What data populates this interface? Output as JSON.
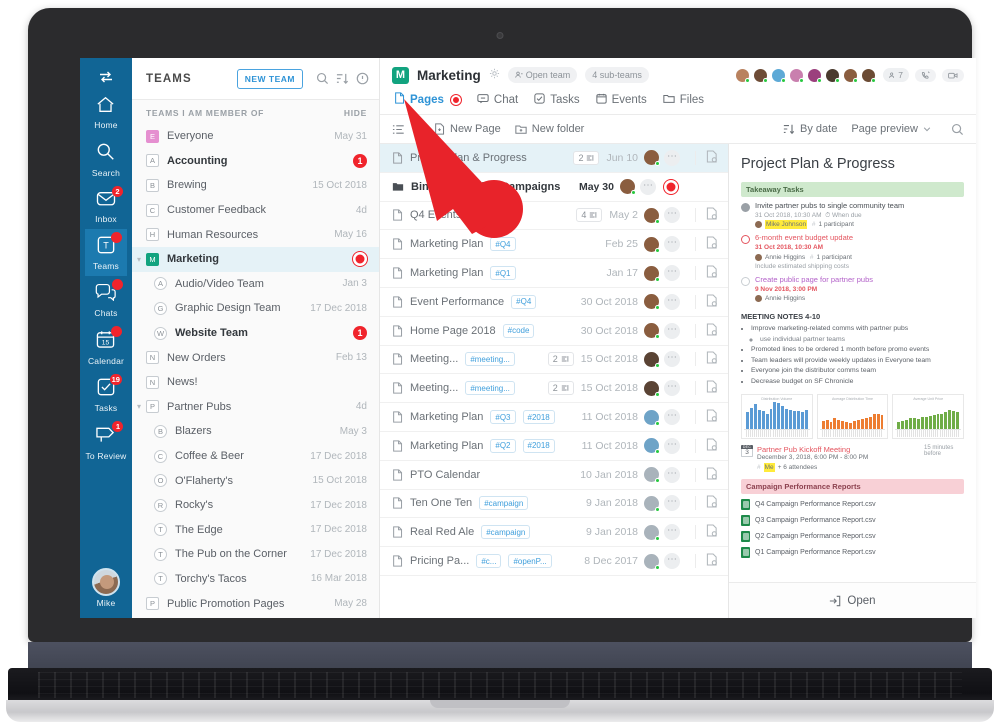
{
  "rail": {
    "toggle_icon": "switch-icon",
    "items": [
      {
        "label": "Home",
        "icon": "home-icon",
        "badge": "",
        "active": false
      },
      {
        "label": "Search",
        "icon": "search-icon",
        "badge": "",
        "active": false
      },
      {
        "label": "Inbox",
        "icon": "inbox-icon",
        "badge": "2",
        "active": false
      },
      {
        "label": "Teams",
        "icon": "teams-icon",
        "badge": " ",
        "active": true
      },
      {
        "label": "Chats",
        "icon": "chats-icon",
        "badge": " ",
        "active": false
      },
      {
        "label": "Calendar",
        "icon": "calendar-icon",
        "badge": " ",
        "active": false
      },
      {
        "label": "Tasks",
        "icon": "tasks-icon",
        "badge": "19",
        "active": false
      },
      {
        "label": "To Review",
        "icon": "to-review-icon",
        "badge": "1",
        "active": false
      }
    ],
    "user_name": "Mike"
  },
  "teams_panel": {
    "title": "TEAMS",
    "new_team_label": "NEW TEAM",
    "search_icon": "search-icon",
    "sort_icon": "sort-icon",
    "info_icon": "info-icon",
    "section_label": "TEAMS I AM MEMBER OF",
    "hide_label": "HIDE",
    "items": [
      {
        "initial": "E",
        "name": "Everyone",
        "date": "May 31",
        "badge": "",
        "bold": false,
        "indent": 0,
        "style": "pink",
        "expandable": false
      },
      {
        "initial": "A",
        "name": "Accounting",
        "date": "",
        "badge": "1",
        "bold": true,
        "indent": 0,
        "style": "plain",
        "expandable": false
      },
      {
        "initial": "B",
        "name": "Brewing",
        "date": "15 Oct 2018",
        "badge": "",
        "bold": false,
        "indent": 0,
        "style": "plain",
        "expandable": false
      },
      {
        "initial": "C",
        "name": "Customer Feedback",
        "date": "4d",
        "badge": "",
        "bold": false,
        "indent": 0,
        "style": "plain",
        "expandable": false
      },
      {
        "initial": "H",
        "name": "Human Resources",
        "date": "May 16",
        "badge": "",
        "bold": false,
        "indent": 0,
        "style": "plain",
        "expandable": false
      },
      {
        "initial": "M",
        "name": "Marketing",
        "date": "",
        "badge": "ring",
        "bold": true,
        "indent": 0,
        "style": "green",
        "expandable": true,
        "selected": true
      },
      {
        "initial": "A",
        "name": "Audio/Video Team",
        "date": "Jan 3",
        "badge": "",
        "bold": false,
        "indent": 1,
        "style": "circ",
        "expandable": false
      },
      {
        "initial": "G",
        "name": "Graphic Design Team",
        "date": "17 Dec 2018",
        "badge": "",
        "bold": false,
        "indent": 1,
        "style": "circ",
        "expandable": false
      },
      {
        "initial": "W",
        "name": "Website Team",
        "date": "",
        "badge": "1",
        "bold": true,
        "indent": 1,
        "style": "circ",
        "expandable": false
      },
      {
        "initial": "N",
        "name": "New Orders",
        "date": "Feb 13",
        "badge": "",
        "bold": false,
        "indent": 0,
        "style": "plain",
        "expandable": false
      },
      {
        "initial": "N",
        "name": "News!",
        "date": "",
        "badge": "",
        "bold": false,
        "indent": 0,
        "style": "plain",
        "expandable": false
      },
      {
        "initial": "P",
        "name": "Partner Pubs",
        "date": "4d",
        "badge": "",
        "bold": false,
        "indent": 0,
        "style": "plain",
        "expandable": true
      },
      {
        "initial": "B",
        "name": "Blazers",
        "date": "May 3",
        "badge": "",
        "bold": false,
        "indent": 1,
        "style": "circ",
        "expandable": false
      },
      {
        "initial": "C",
        "name": "Coffee & Beer",
        "date": "17 Dec 2018",
        "badge": "",
        "bold": false,
        "indent": 1,
        "style": "circ",
        "expandable": false
      },
      {
        "initial": "O",
        "name": "O'Flaherty's",
        "date": "15 Oct 2018",
        "badge": "",
        "bold": false,
        "indent": 1,
        "style": "circ",
        "expandable": false
      },
      {
        "initial": "R",
        "name": "Rocky's",
        "date": "17 Dec 2018",
        "badge": "",
        "bold": false,
        "indent": 1,
        "style": "circ",
        "expandable": false
      },
      {
        "initial": "T",
        "name": "The Edge",
        "date": "17 Dec 2018",
        "badge": "",
        "bold": false,
        "indent": 1,
        "style": "circ",
        "expandable": false
      },
      {
        "initial": "T",
        "name": "The Pub on the Corner",
        "date": "17 Dec 2018",
        "badge": "",
        "bold": false,
        "indent": 1,
        "style": "circ",
        "expandable": false
      },
      {
        "initial": "T",
        "name": "Torchy's Tacos",
        "date": "16 Mar 2018",
        "badge": "",
        "bold": false,
        "indent": 1,
        "style": "circ",
        "expandable": false
      },
      {
        "initial": "P",
        "name": "Public Promotion Pages",
        "date": "May 28",
        "badge": "",
        "bold": false,
        "indent": 0,
        "style": "plain",
        "expandable": false
      }
    ]
  },
  "channel": {
    "initial": "M",
    "name": "Marketing",
    "gear_icon": "gear-icon",
    "open_team_pill": "Open team",
    "sub_teams_pill": "4 sub-teams",
    "members_count": "7",
    "call_icon": "phone-icon",
    "video_icon": "video-icon",
    "tabs": [
      {
        "label": "Pages",
        "icon": "page-icon",
        "active": true,
        "dot": true
      },
      {
        "label": "Chat",
        "icon": "chat-icon",
        "active": false,
        "dot": false
      },
      {
        "label": "Tasks",
        "icon": "check-icon",
        "active": false,
        "dot": false
      },
      {
        "label": "Events",
        "icon": "calendar-icon",
        "active": false,
        "dot": false
      },
      {
        "label": "Files",
        "icon": "folder-icon",
        "active": false,
        "dot": false
      }
    ]
  },
  "toolbar": {
    "list_view_icon": "list-view-icon",
    "new_page_label": "New Page",
    "new_folder_label": "New folder",
    "sort_label": "By date",
    "sort_icon": "sort-icon",
    "preview_label": "Page preview",
    "search_icon": "search-icon"
  },
  "files": [
    {
      "name": "Project Plan & Progress",
      "type": "page",
      "tags": [],
      "comments": "2",
      "date": "Jun 10",
      "bold": false,
      "selected": true,
      "has_end_icon": true,
      "unread": false
    },
    {
      "name": "Bine Advertising Campaigns",
      "type": "folder",
      "tags": [],
      "comments": "",
      "date": "May 30",
      "bold": true,
      "selected": false,
      "has_end_icon": false,
      "unread": true
    },
    {
      "name": "Q4 Events",
      "type": "page",
      "tags": [],
      "comments": "4",
      "date": "May 2",
      "bold": false,
      "selected": false,
      "has_end_icon": true,
      "unread": false
    },
    {
      "name": "Marketing Plan",
      "type": "page",
      "tags": [
        "#Q4"
      ],
      "comments": "",
      "date": "Feb 25",
      "bold": false,
      "selected": false,
      "has_end_icon": true,
      "unread": false
    },
    {
      "name": "Marketing Plan",
      "type": "page",
      "tags": [
        "#Q1"
      ],
      "comments": "",
      "date": "Jan 17",
      "bold": false,
      "selected": false,
      "has_end_icon": true,
      "unread": false
    },
    {
      "name": "Event Performance",
      "type": "page",
      "tags": [
        "#Q4"
      ],
      "comments": "",
      "date": "30 Oct 2018",
      "bold": false,
      "selected": false,
      "has_end_icon": true,
      "unread": false
    },
    {
      "name": "Home Page 2018",
      "type": "page",
      "tags": [
        "#code"
      ],
      "comments": "",
      "date": "30 Oct 2018",
      "bold": false,
      "selected": false,
      "has_end_icon": true,
      "unread": false
    },
    {
      "name": "Meeting...",
      "type": "page",
      "tags": [
        "#meeting..."
      ],
      "comments": "2",
      "date": "15 Oct 2018",
      "bold": false,
      "selected": false,
      "has_end_icon": true,
      "unread": false
    },
    {
      "name": "Meeting...",
      "type": "page",
      "tags": [
        "#meeting..."
      ],
      "comments": "2",
      "date": "15 Oct 2018",
      "bold": false,
      "selected": false,
      "has_end_icon": true,
      "unread": false
    },
    {
      "name": "Marketing Plan",
      "type": "page",
      "tags": [
        "#Q3",
        "#2018"
      ],
      "comments": "",
      "date": "11 Oct 2018",
      "bold": false,
      "selected": false,
      "has_end_icon": true,
      "unread": false
    },
    {
      "name": "Marketing Plan",
      "type": "page",
      "tags": [
        "#Q2",
        "#2018"
      ],
      "comments": "",
      "date": "11 Oct 2018",
      "bold": false,
      "selected": false,
      "has_end_icon": true,
      "unread": false
    },
    {
      "name": "PTO Calendar",
      "type": "page",
      "tags": [],
      "comments": "",
      "date": "10 Jan 2018",
      "bold": false,
      "selected": false,
      "has_end_icon": true,
      "unread": false
    },
    {
      "name": "Ten One Ten",
      "type": "page",
      "tags": [
        "#campaign"
      ],
      "comments": "",
      "date": "9 Jan 2018",
      "bold": false,
      "selected": false,
      "has_end_icon": true,
      "unread": false
    },
    {
      "name": "Real Red Ale",
      "type": "page",
      "tags": [
        "#campaign"
      ],
      "comments": "",
      "date": "9 Jan 2018",
      "bold": false,
      "selected": false,
      "has_end_icon": true,
      "unread": false
    },
    {
      "name": "Pricing Pa...",
      "type": "page",
      "tags": [
        "#c...",
        "#openP..."
      ],
      "comments": "",
      "date": "8 Dec 2017",
      "bold": false,
      "selected": false,
      "has_end_icon": true,
      "unread": false
    }
  ],
  "preview": {
    "title": "Project Plan & Progress",
    "takeaway_band": "Takeaway Tasks",
    "tasks": [
      {
        "state": "done",
        "title": "Invite partner pubs to single community team",
        "meta": "31 Oct 2018, 10:30 AM",
        "meta2": "When due",
        "person": "Mike Johnson",
        "person_highlight": true,
        "participants": "1 participant",
        "note": ""
      },
      {
        "state": "late",
        "title": "6-month event budget update",
        "meta": "31 Oct 2018, 10:30 AM",
        "meta2": "",
        "person": "Annie Higgins",
        "person_highlight": false,
        "participants": "1 participant",
        "note": "Include estimated shipping costs"
      },
      {
        "state": "open",
        "title": "Create public page for partner pubs",
        "meta": "9 Nov 2018, 3:00 PM",
        "meta2": "",
        "person": "Annie Higgins",
        "person_highlight": false,
        "participants": "",
        "note": ""
      }
    ],
    "notes_heading": "MEETING NOTES 4-10",
    "notes": [
      {
        "text": "Improve marketing-related comms with partner pubs",
        "sub": false
      },
      {
        "text": "use individual partner teams",
        "sub": true
      },
      {
        "text": "Promoted lines to be ordered 1 month before promo events",
        "sub": false
      },
      {
        "text": "Team leaders will provide weekly updates in Everyone team",
        "sub": false
      },
      {
        "text": "Everyone join the distributor comms team",
        "sub": false
      },
      {
        "text": "Decrease budget on SF Chronicle",
        "sub": false
      }
    ],
    "event": {
      "cal_month": "DEC",
      "cal_day": "3",
      "title": "Partner Pub Kickoff Meeting",
      "datetime": "December 3, 2018, 6:00 PM - 8:00 PM",
      "attendees_me": "Me",
      "attendees_rest": "+ 6 attendees",
      "reminder": "15 minutes before"
    },
    "reports_band": "Campaign Performance Reports",
    "reports": [
      "Q4 Campaign Performance Report.csv",
      "Q3 Campaign Performance Report.csv",
      "Q2 Campaign Performance Report.csv",
      "Q1 Campaign Performance Report.csv"
    ],
    "open_label": "Open",
    "open_icon": "open-icon"
  },
  "chart_data": [
    {
      "type": "bar",
      "title": "Distribution Volume",
      "color": "#5b9bd5",
      "categories": [
        "1",
        "2",
        "3",
        "4",
        "5",
        "6",
        "7",
        "8",
        "9",
        "10",
        "11",
        "12",
        "13",
        "14",
        "15",
        "16"
      ],
      "values": [
        62,
        78,
        92,
        70,
        66,
        55,
        74,
        100,
        96,
        86,
        74,
        70,
        68,
        66,
        64,
        70
      ],
      "xlabel": "",
      "ylabel": "",
      "ylim": [
        0,
        100
      ]
    },
    {
      "type": "bar",
      "title": "Average Distribution Time",
      "color": "#ed7d31",
      "categories": [
        "1",
        "2",
        "3",
        "4",
        "5",
        "6",
        "7",
        "8",
        "9",
        "10",
        "11",
        "12",
        "13",
        "14",
        "15",
        "16"
      ],
      "values": [
        30,
        34,
        26,
        40,
        36,
        30,
        26,
        24,
        30,
        34,
        38,
        42,
        44,
        58,
        56,
        54
      ],
      "xlabel": "",
      "ylabel": "",
      "ylim": [
        0,
        100
      ]
    },
    {
      "type": "bar",
      "title": "Average Unit Price",
      "color": "#70ad47",
      "categories": [
        "1",
        "2",
        "3",
        "4",
        "5",
        "6",
        "7",
        "8",
        "9",
        "10",
        "11",
        "12",
        "13",
        "14",
        "15",
        "16"
      ],
      "values": [
        26,
        30,
        36,
        42,
        40,
        38,
        44,
        46,
        50,
        52,
        56,
        58,
        62,
        70,
        66,
        62
      ],
      "xlabel": "",
      "ylabel": "",
      "ylim": [
        0,
        100
      ]
    }
  ],
  "annotation": {
    "pointer_icon": "arrow-pointer",
    "target_color": "#e8232a"
  }
}
